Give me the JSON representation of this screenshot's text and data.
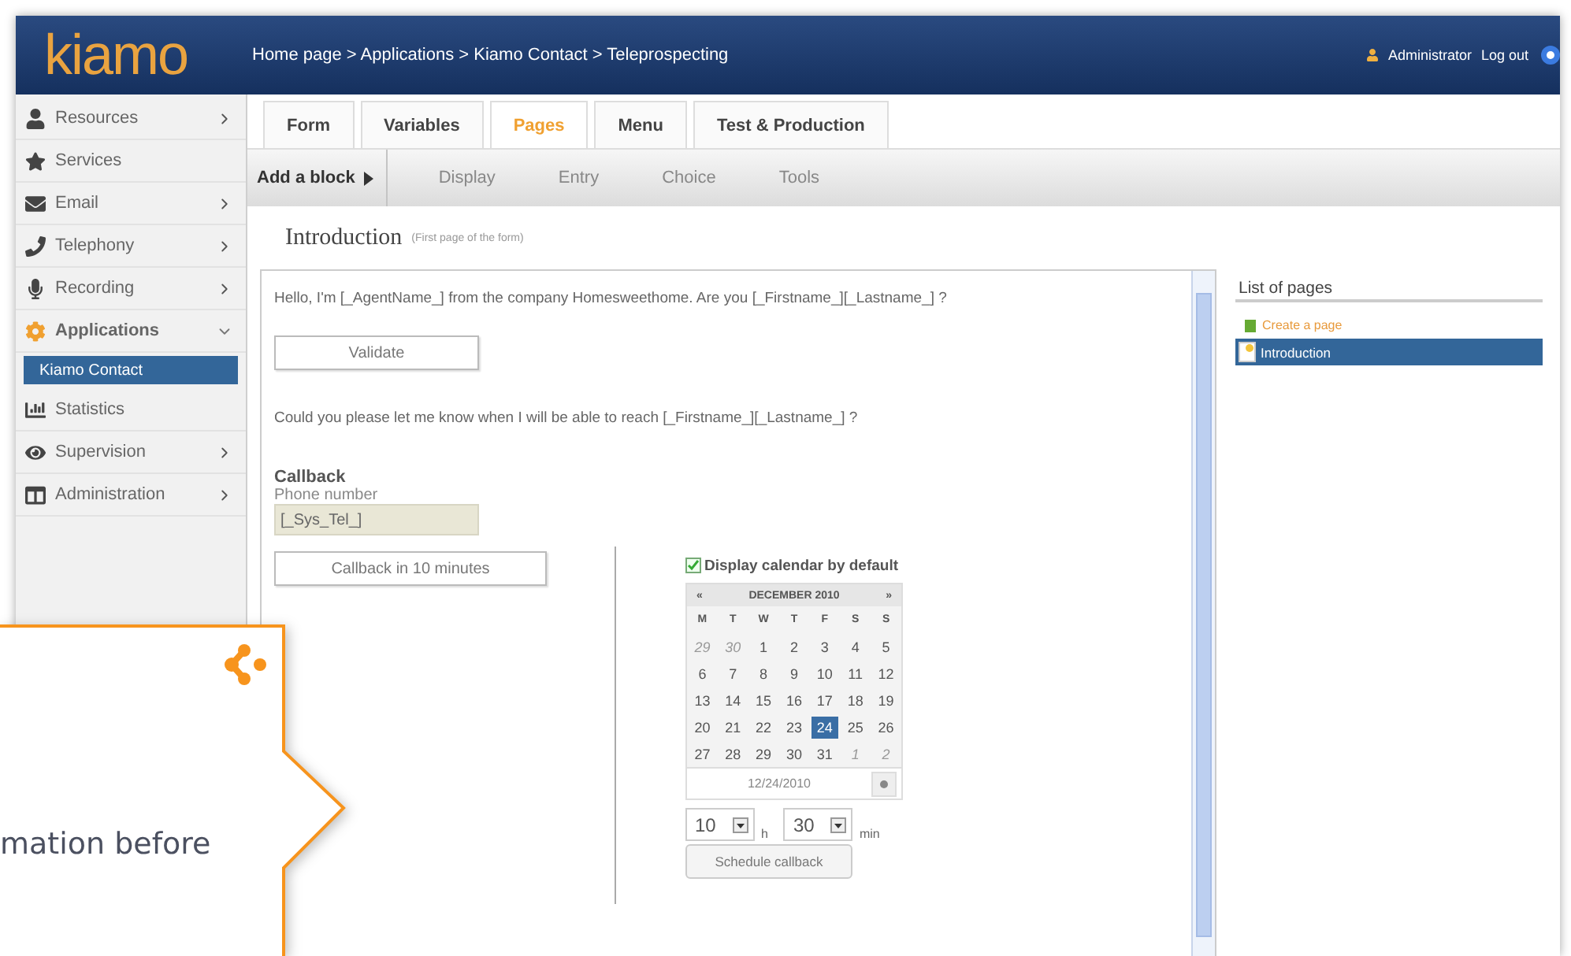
{
  "header": {
    "logo": "kiamo",
    "breadcrumb": "Home page > Applications > Kiamo Contact > Teleprospecting",
    "user": "Administrator",
    "logout": "Log out"
  },
  "sidebar": {
    "items": [
      {
        "label": "Resources",
        "expandable": true,
        "expanded": false
      },
      {
        "label": "Services",
        "expandable": false,
        "expanded": false
      },
      {
        "label": "Email",
        "expandable": true,
        "expanded": false
      },
      {
        "label": "Telephony",
        "expandable": true,
        "expanded": false
      },
      {
        "label": "Recording",
        "expandable": true,
        "expanded": false
      },
      {
        "label": "Applications",
        "expandable": true,
        "expanded": true,
        "children": [
          {
            "label": "Kiamo Contact",
            "selected": true
          }
        ]
      },
      {
        "label": "Statistics",
        "expandable": false,
        "expanded": false
      },
      {
        "label": "Supervision",
        "expandable": true,
        "expanded": false
      },
      {
        "label": "Administration",
        "expandable": true,
        "expanded": false
      }
    ]
  },
  "tabs": [
    {
      "label": "Form",
      "selected": false
    },
    {
      "label": "Variables",
      "selected": false
    },
    {
      "label": "Pages",
      "selected": true
    },
    {
      "label": "Menu",
      "selected": false
    },
    {
      "label": "Test & Production",
      "selected": false
    }
  ],
  "toolbar": {
    "add_block": "Add a block",
    "items": [
      "Display",
      "Entry",
      "Choice",
      "Tools"
    ]
  },
  "page": {
    "title": "Introduction",
    "subtitle": "(First page of the form)"
  },
  "form": {
    "greeting": "Hello, I'm [_AgentName_] from the company Homesweethome. Are you [_Firstname_][_Lastname_] ?",
    "validate": "Validate",
    "question": "Could you please let me know when I will be able to reach [_Firstname_][_Lastname_] ?",
    "callback": {
      "title": "Callback",
      "phone_label": "Phone number",
      "phone_value": "[_Sys_Tel_]",
      "quick_button": "Callback in 10 minutes"
    },
    "calendar": {
      "checkbox": {
        "label": "Display calendar by default",
        "checked": true
      },
      "prev": "«",
      "month": "DECEMBER 2010",
      "next": "»",
      "weekdays": [
        "M",
        "T",
        "W",
        "T",
        "F",
        "S",
        "S"
      ],
      "weeks": [
        [
          {
            "day": "29",
            "outside": true,
            "selected": false
          },
          {
            "day": "30",
            "outside": true,
            "selected": false
          },
          {
            "day": "1",
            "outside": false,
            "selected": false
          },
          {
            "day": "2",
            "outside": false,
            "selected": false
          },
          {
            "day": "3",
            "outside": false,
            "selected": false
          },
          {
            "day": "4",
            "outside": false,
            "selected": false
          },
          {
            "day": "5",
            "outside": false,
            "selected": false
          }
        ],
        [
          {
            "day": "6",
            "outside": false,
            "selected": false
          },
          {
            "day": "7",
            "outside": false,
            "selected": false
          },
          {
            "day": "8",
            "outside": false,
            "selected": false
          },
          {
            "day": "9",
            "outside": false,
            "selected": false
          },
          {
            "day": "10",
            "outside": false,
            "selected": false
          },
          {
            "day": "11",
            "outside": false,
            "selected": false
          },
          {
            "day": "12",
            "outside": false,
            "selected": false
          }
        ],
        [
          {
            "day": "13",
            "outside": false,
            "selected": false
          },
          {
            "day": "14",
            "outside": false,
            "selected": false
          },
          {
            "day": "15",
            "outside": false,
            "selected": false
          },
          {
            "day": "16",
            "outside": false,
            "selected": false
          },
          {
            "day": "17",
            "outside": false,
            "selected": false
          },
          {
            "day": "18",
            "outside": false,
            "selected": false
          },
          {
            "day": "19",
            "outside": false,
            "selected": false
          }
        ],
        [
          {
            "day": "20",
            "outside": false,
            "selected": false
          },
          {
            "day": "21",
            "outside": false,
            "selected": false
          },
          {
            "day": "22",
            "outside": false,
            "selected": false
          },
          {
            "day": "23",
            "outside": false,
            "selected": false
          },
          {
            "day": "24",
            "outside": false,
            "selected": true
          },
          {
            "day": "25",
            "outside": false,
            "selected": false
          },
          {
            "day": "26",
            "outside": false,
            "selected": false
          }
        ],
        [
          {
            "day": "27",
            "outside": false,
            "selected": false
          },
          {
            "day": "28",
            "outside": false,
            "selected": false
          },
          {
            "day": "29",
            "outside": false,
            "selected": false
          },
          {
            "day": "30",
            "outside": false,
            "selected": false
          },
          {
            "day": "31",
            "outside": false,
            "selected": false
          },
          {
            "day": "1",
            "outside": true,
            "selected": false
          },
          {
            "day": "2",
            "outside": true,
            "selected": false
          }
        ]
      ],
      "date": "12/24/2010",
      "hour": "10",
      "hour_unit": "h",
      "minute": "30",
      "minute_unit": "min",
      "schedule": "Schedule callback"
    }
  },
  "pages_panel": {
    "title": "List of pages",
    "create": "Create a page",
    "pages": [
      {
        "label": "Introduction",
        "selected": true
      }
    ]
  },
  "callout": {
    "text": "mation before"
  }
}
